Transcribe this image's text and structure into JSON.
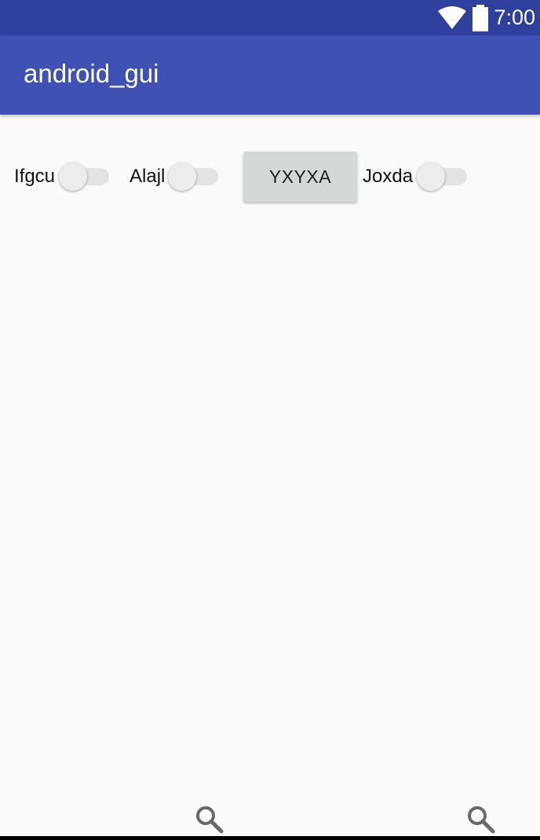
{
  "status_bar": {
    "time": "7:00",
    "wifi_icon": "wifi-icon",
    "battery_icon": "battery-icon",
    "color": "#2f3f9e"
  },
  "app_bar": {
    "title": "android_gui",
    "color": "#3f51b5"
  },
  "content": {
    "switches": [
      {
        "label": "Ifgcu",
        "checked": false
      },
      {
        "label": "Alajl",
        "checked": false
      },
      {
        "label": "Joxda",
        "checked": false
      }
    ],
    "button": {
      "label": "YXYXA"
    }
  },
  "bottom": {
    "icons": [
      "search-icon",
      "search-icon"
    ]
  }
}
